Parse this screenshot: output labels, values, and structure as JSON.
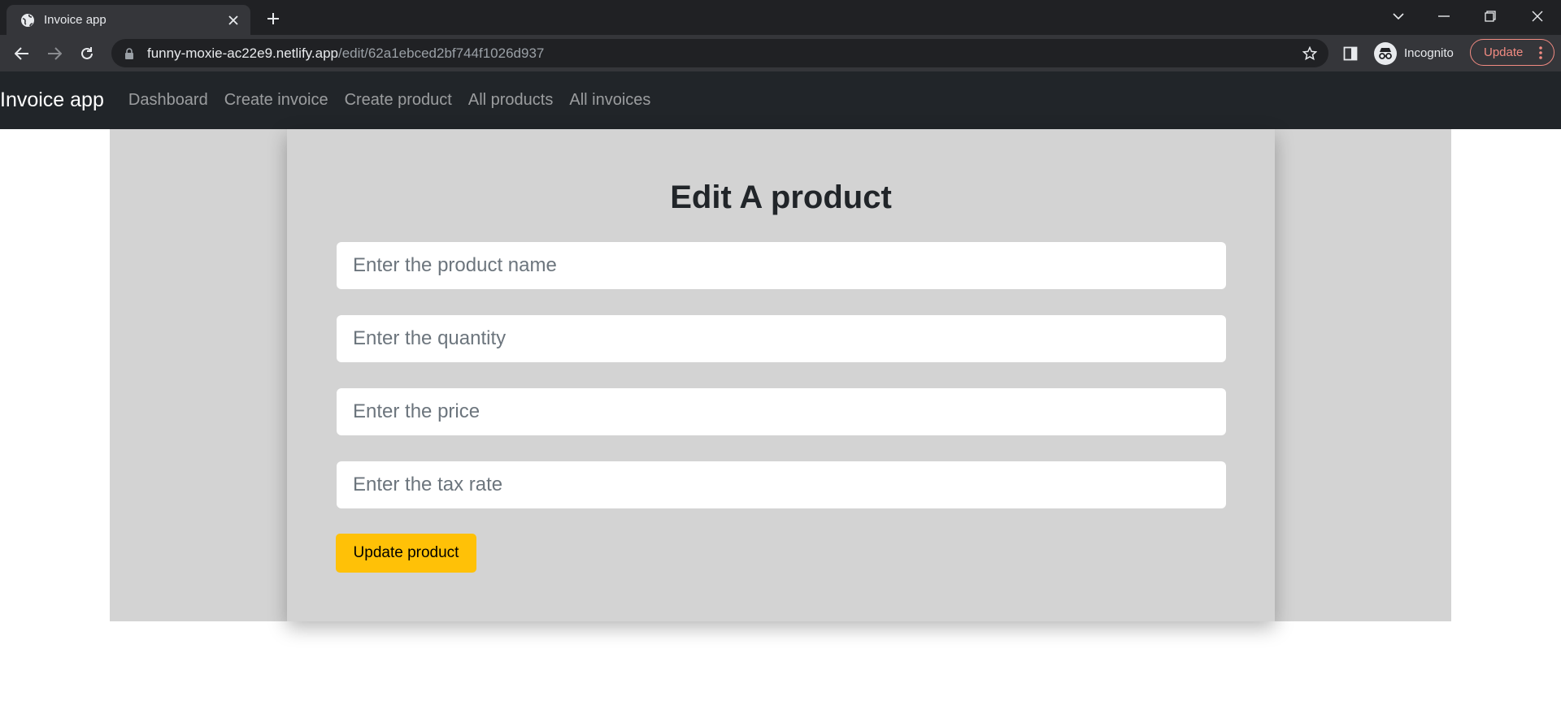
{
  "browser": {
    "tab": {
      "title": "Invoice app",
      "favicon": "globe-icon"
    },
    "url": {
      "host": "funny-moxie-ac22e9.netlify.app",
      "path": "/edit/62a1ebced2bf744f1026d937"
    },
    "profile_label": "Incognito",
    "update_label": "Update",
    "colors": {
      "update_accent": "#f28b82"
    }
  },
  "navbar": {
    "brand": "Invoice app",
    "links": [
      "Dashboard",
      "Create invoice",
      "Create product",
      "All products",
      "All invoices"
    ]
  },
  "form": {
    "title": "Edit A product",
    "fields": {
      "name": {
        "placeholder": "Enter the product name",
        "value": ""
      },
      "quantity": {
        "placeholder": "Enter the quantity",
        "value": ""
      },
      "price": {
        "placeholder": "Enter the price",
        "value": ""
      },
      "tax_rate": {
        "placeholder": "Enter the tax rate",
        "value": ""
      }
    },
    "submit_label": "Update product"
  },
  "colors": {
    "navbar_bg": "#212529",
    "panel_bg": "#d3d3d3",
    "button_bg": "#ffc107"
  }
}
